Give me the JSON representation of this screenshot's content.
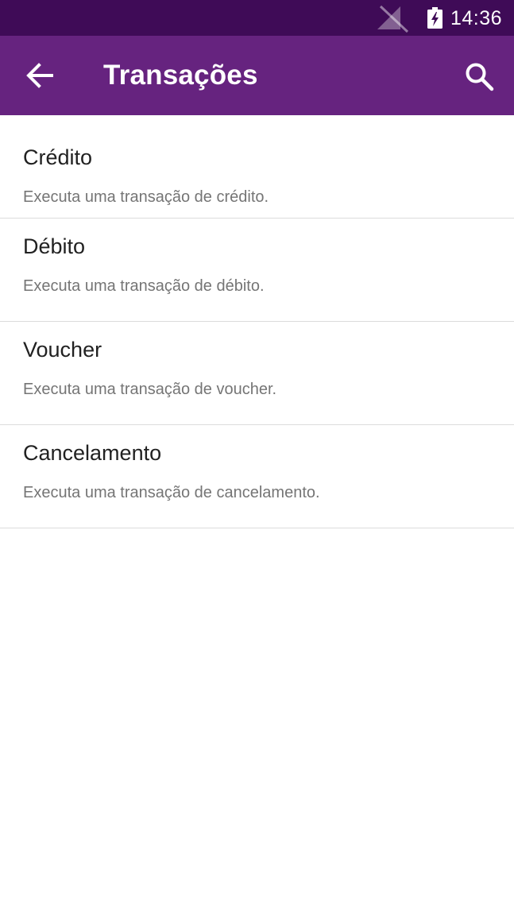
{
  "status_bar": {
    "time": "14:36",
    "icons": [
      "no-signal-icon",
      "battery-charging-icon"
    ],
    "background": "#3f0b57"
  },
  "app_bar": {
    "title": "Transações",
    "back_icon": "arrow-left-icon",
    "search_icon": "search-icon",
    "background": "#66237f"
  },
  "transactions": [
    {
      "title": "Crédito",
      "summary": "Executa uma transação de crédito."
    },
    {
      "title": "Débito",
      "summary": "Executa uma transação de débito."
    },
    {
      "title": "Voucher",
      "summary": "Executa uma transação de voucher."
    },
    {
      "title": "Cancelamento",
      "summary": "Executa uma transação de cancelamento."
    }
  ]
}
